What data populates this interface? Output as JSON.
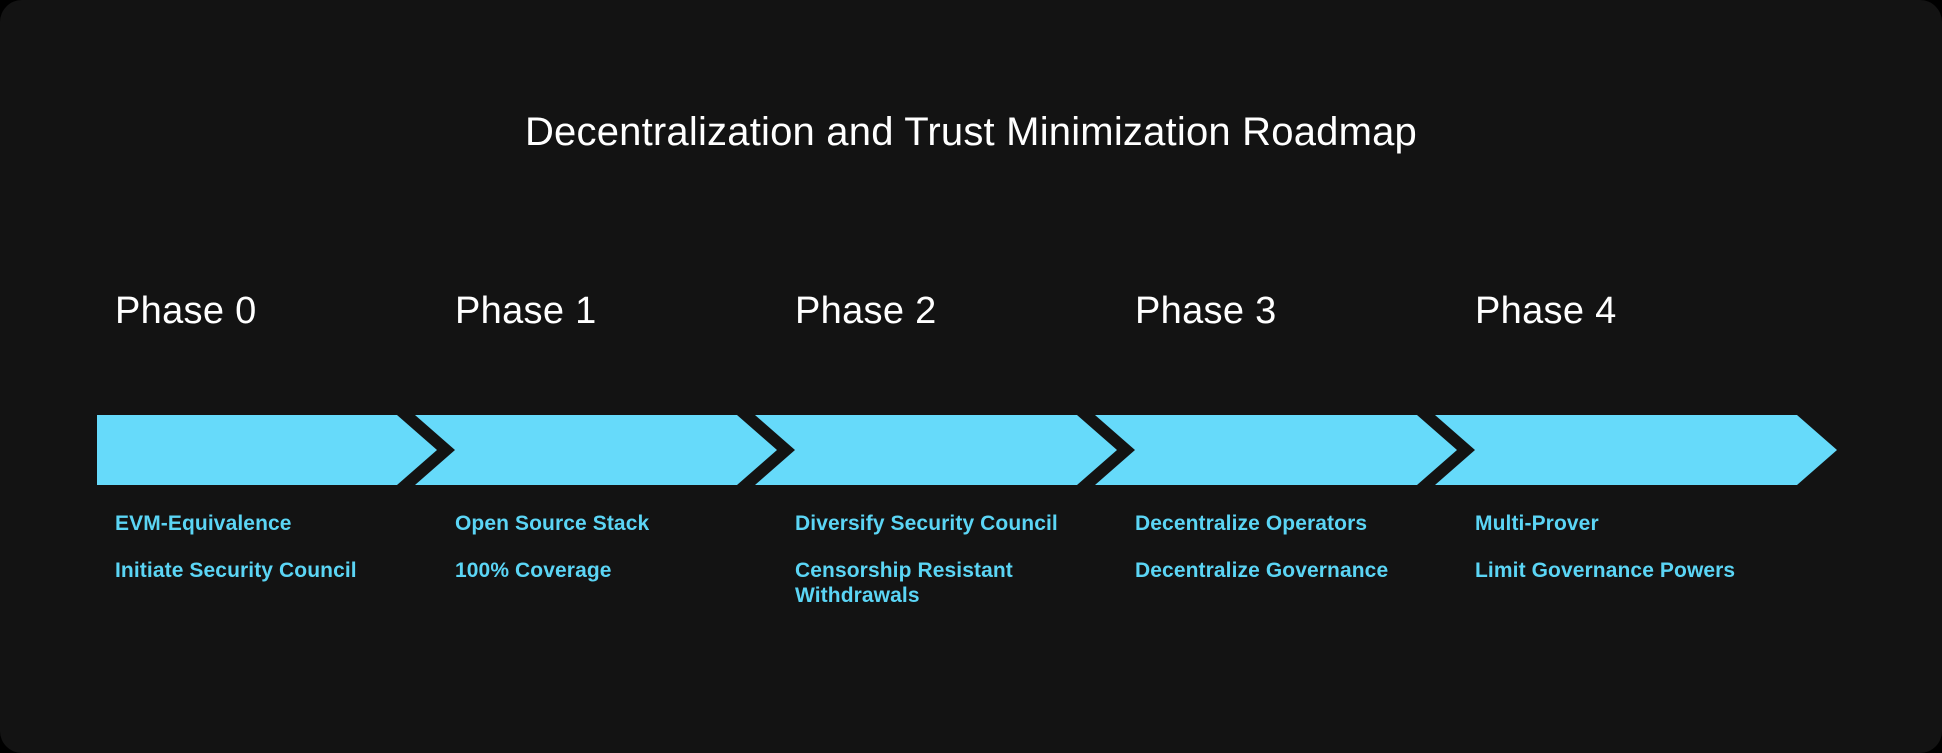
{
  "title": "Decentralization and Trust Minimization Roadmap",
  "colors": {
    "page_background": "#000000",
    "panel_background": "#131313",
    "arrow_fill": "#66DAFA",
    "heading_text": "#FFFFFF",
    "item_text": "#5BD5F5"
  },
  "chart_data": {
    "type": "diagram",
    "subtype": "chevron-roadmap",
    "title": "Decentralization and Trust Minimization Roadmap",
    "orientation": "horizontal-left-to-right",
    "phase_count": 5,
    "categories": [
      "Phase 0",
      "Phase 1",
      "Phase 2",
      "Phase 3",
      "Phase 4"
    ],
    "series": [
      {
        "name": "Phase 0",
        "values": [
          "EVM-Equivalence",
          "Initiate Security Council"
        ]
      },
      {
        "name": "Phase 1",
        "values": [
          "Open Source Stack",
          "100% Coverage"
        ]
      },
      {
        "name": "Phase 2",
        "values": [
          "Diversify Security Council",
          "Censorship Resistant Withdrawals"
        ]
      },
      {
        "name": "Phase 3",
        "values": [
          "Decentralize Operators",
          "Decentralize Governance"
        ]
      },
      {
        "name": "Phase 4",
        "values": [
          "Multi-Prover",
          "Limit Governance Powers"
        ]
      }
    ]
  },
  "phases": [
    {
      "heading": "Phase 0",
      "item1": "EVM-Equivalence",
      "item2": "Initiate Security Council"
    },
    {
      "heading": "Phase 1",
      "item1": "Open Source Stack",
      "item2": "100% Coverage"
    },
    {
      "heading": "Phase 2",
      "item1": "Diversify Security Council",
      "item2": "Censorship Resistant Withdrawals"
    },
    {
      "heading": "Phase 3",
      "item1": "Decentralize Operators",
      "item2": "Decentralize Governance"
    },
    {
      "heading": "Phase 4",
      "item1": "Multi-Prover",
      "item2": "Limit Governance Powers"
    }
  ]
}
